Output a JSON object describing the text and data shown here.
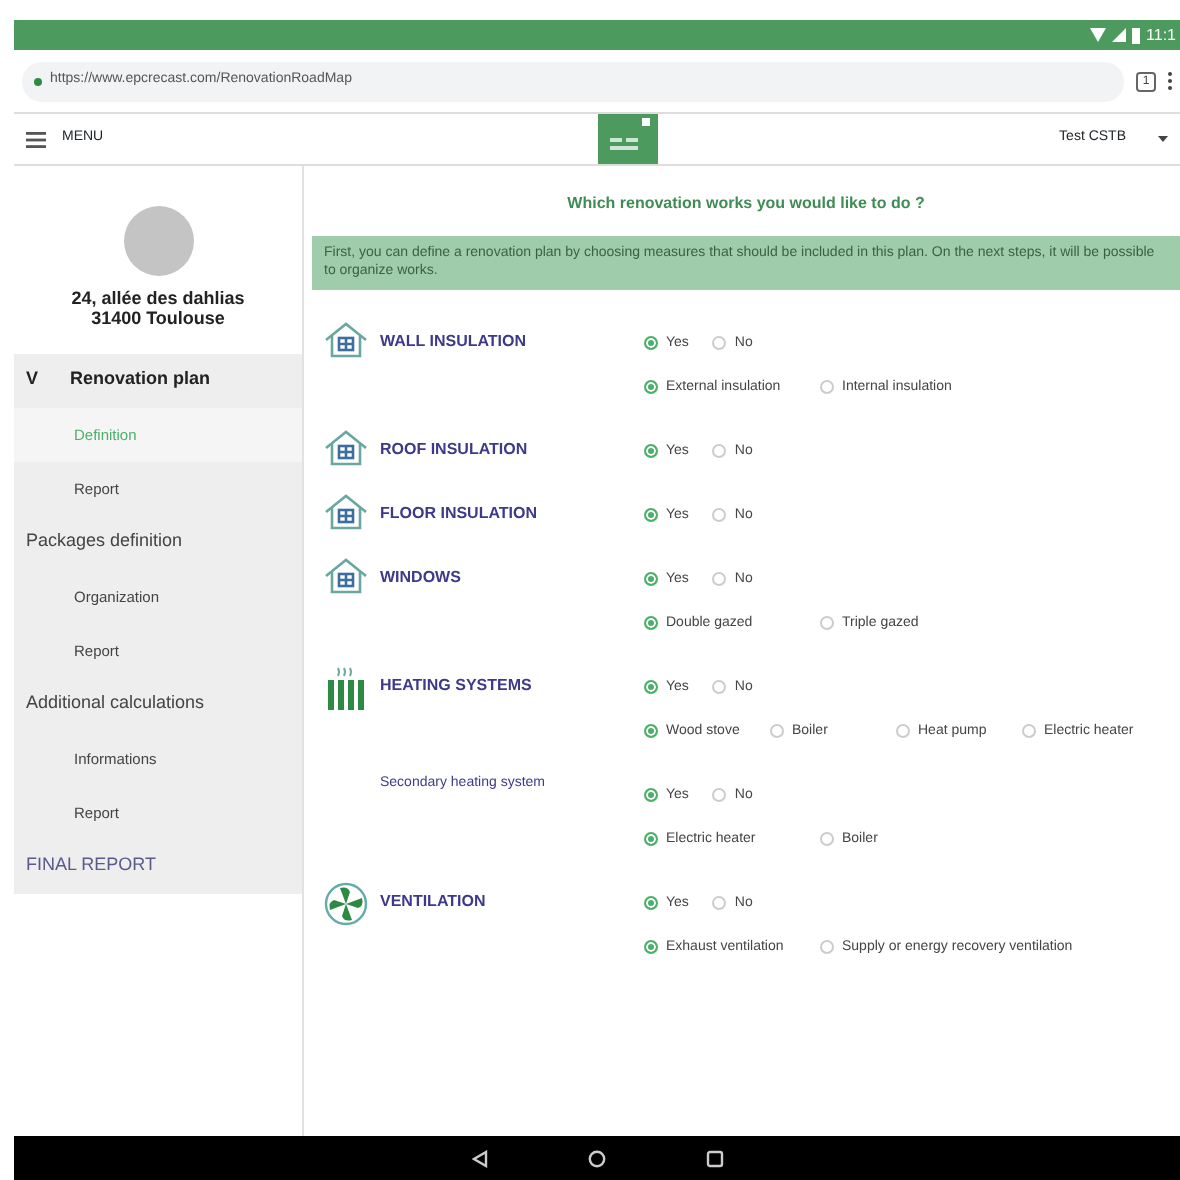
{
  "status_bar": {
    "time": "11:1"
  },
  "browser": {
    "url": "https://www.epcrecast.com/RenovationRoadMap",
    "tab_count": "1"
  },
  "header": {
    "menu_label": "MENU",
    "user": "Test CSTB"
  },
  "sidebar": {
    "address": [
      "24, allée des dahlias",
      "31400 Toulouse"
    ],
    "items": [
      {
        "label": "Renovation plan",
        "marker": "V",
        "expanded": true,
        "selected": false,
        "children": [
          {
            "label": "Definition",
            "selected": true
          },
          {
            "label": "Report",
            "selected": false
          }
        ]
      },
      {
        "label": "Packages definition",
        "selected": false,
        "children": [
          {
            "label": "Organization",
            "selected": false
          },
          {
            "label": "Report",
            "selected": false
          }
        ]
      },
      {
        "label": "Additional calculations",
        "selected": false,
        "children": [
          {
            "label": "Informations",
            "selected": false
          },
          {
            "label": "Report",
            "selected": false
          }
        ]
      },
      {
        "label": "FINAL REPORT",
        "selected": false
      }
    ]
  },
  "main": {
    "heading": "Which renovation works you would like to do ?",
    "intro": "First, you can define a renovation plan by choosing measures that should be included in this plan. On the next steps, it will be possible to organize works.",
    "measures": [
      {
        "kind": "house",
        "title": "WALL INSULATION",
        "answer": [
          {
            "label": "Yes",
            "selected": true
          },
          {
            "label": "No",
            "selected": false
          }
        ],
        "options": [
          {
            "label": "External insulation",
            "selected": true
          },
          {
            "label": "Internal insulation",
            "selected": false
          }
        ]
      },
      {
        "kind": "house",
        "title": "ROOF INSULATION",
        "answer": [
          {
            "label": "Yes",
            "selected": true
          },
          {
            "label": "No",
            "selected": false
          }
        ]
      },
      {
        "kind": "house",
        "title": "FLOOR INSULATION",
        "answer": [
          {
            "label": "Yes",
            "selected": true
          },
          {
            "label": "No",
            "selected": false
          }
        ]
      },
      {
        "kind": "house",
        "title": "WINDOWS",
        "answer": [
          {
            "label": "Yes",
            "selected": true
          },
          {
            "label": "No",
            "selected": false
          }
        ],
        "options": [
          {
            "label": "Double gazed",
            "selected": true
          },
          {
            "label": "Triple gazed",
            "selected": false
          }
        ]
      },
      {
        "kind": "radiator",
        "title": "HEATING SYSTEMS",
        "answer": [
          {
            "label": "Yes",
            "selected": true
          },
          {
            "label": "No",
            "selected": false
          }
        ],
        "options": [
          {
            "label": "Wood stove",
            "selected": true
          },
          {
            "label": "Boiler",
            "selected": false
          },
          {
            "label": "Heat pump",
            "selected": false
          },
          {
            "label": "Electric heater",
            "selected": false
          }
        ]
      },
      {
        "kind": "sub",
        "title": "Secondary heating system",
        "answer": [
          {
            "label": "Yes",
            "selected": true
          },
          {
            "label": "No",
            "selected": false
          }
        ],
        "options": [
          {
            "label": "Electric heater",
            "selected": true
          },
          {
            "label": "Boiler",
            "selected": false
          }
        ]
      },
      {
        "kind": "fan",
        "title": "VENTILATION",
        "answer": [
          {
            "label": "Yes",
            "selected": true
          },
          {
            "label": "No",
            "selected": false
          }
        ],
        "options": [
          {
            "label": "Exhaust ventilation",
            "selected": true
          },
          {
            "label": "Supply or energy recovery ventilation",
            "selected": false
          }
        ]
      }
    ]
  }
}
